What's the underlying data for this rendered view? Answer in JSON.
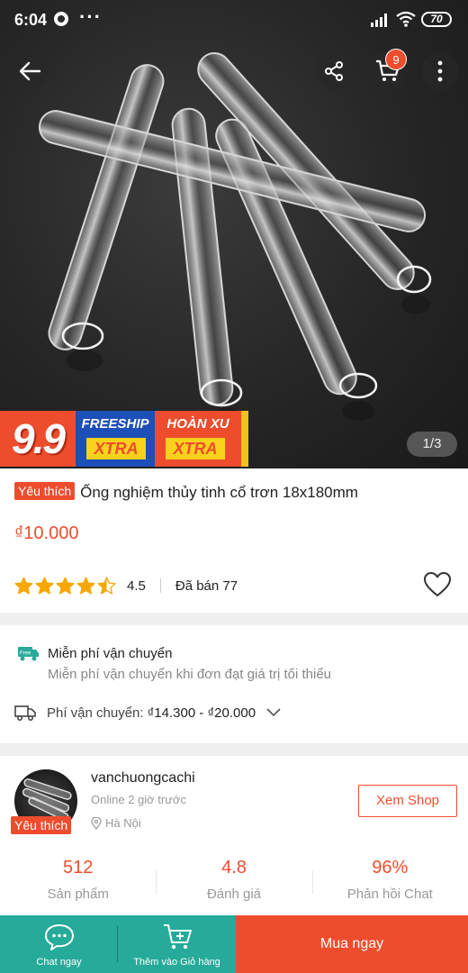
{
  "status_bar": {
    "time": "6:04",
    "dots": "···",
    "battery": "70"
  },
  "top_actions": {
    "cart_count": "9"
  },
  "gallery": {
    "pager": "1/3"
  },
  "promo": {
    "nine": "9.9",
    "freeship": "FREESHIP",
    "hoanxu": "HOÀN XU",
    "xtra": "XTRA"
  },
  "product": {
    "badge": "Yêu thích",
    "name": "Ống nghiệm thủy tinh cổ trơn 18x180mm",
    "price": "₫10.000",
    "rating": "4.5",
    "rating_value": 4.5,
    "sold": "Đã bán 77"
  },
  "shipping": {
    "free_title": "Miễn phí vận chuyển",
    "free_sub": "Miễn phí vận chuyển khi đơn đạt giá trị tối thiểu",
    "fee_label": "Phí vận chuyển:",
    "fee_value": "₫14.300 - ₫20.000"
  },
  "shop": {
    "name": "vanchuongcachi",
    "online": "Online 2 giờ trước",
    "location": "Hà Nội",
    "badge": "Yêu thích",
    "view_button": "Xem Shop",
    "stats": [
      {
        "value": "512",
        "label": "Sản phẩm"
      },
      {
        "value": "4.8",
        "label": "Đánh giá"
      },
      {
        "value": "96%",
        "label": "Phản hồi Chat"
      }
    ]
  },
  "bottom_bar": {
    "chat": "Chat ngay",
    "add_cart": "Thêm vào Giỏ hàng",
    "buy": "Mua ngay"
  },
  "colors": {
    "brand": "#ee4d2d",
    "teal": "#26aa99",
    "star": "#f6a700"
  }
}
